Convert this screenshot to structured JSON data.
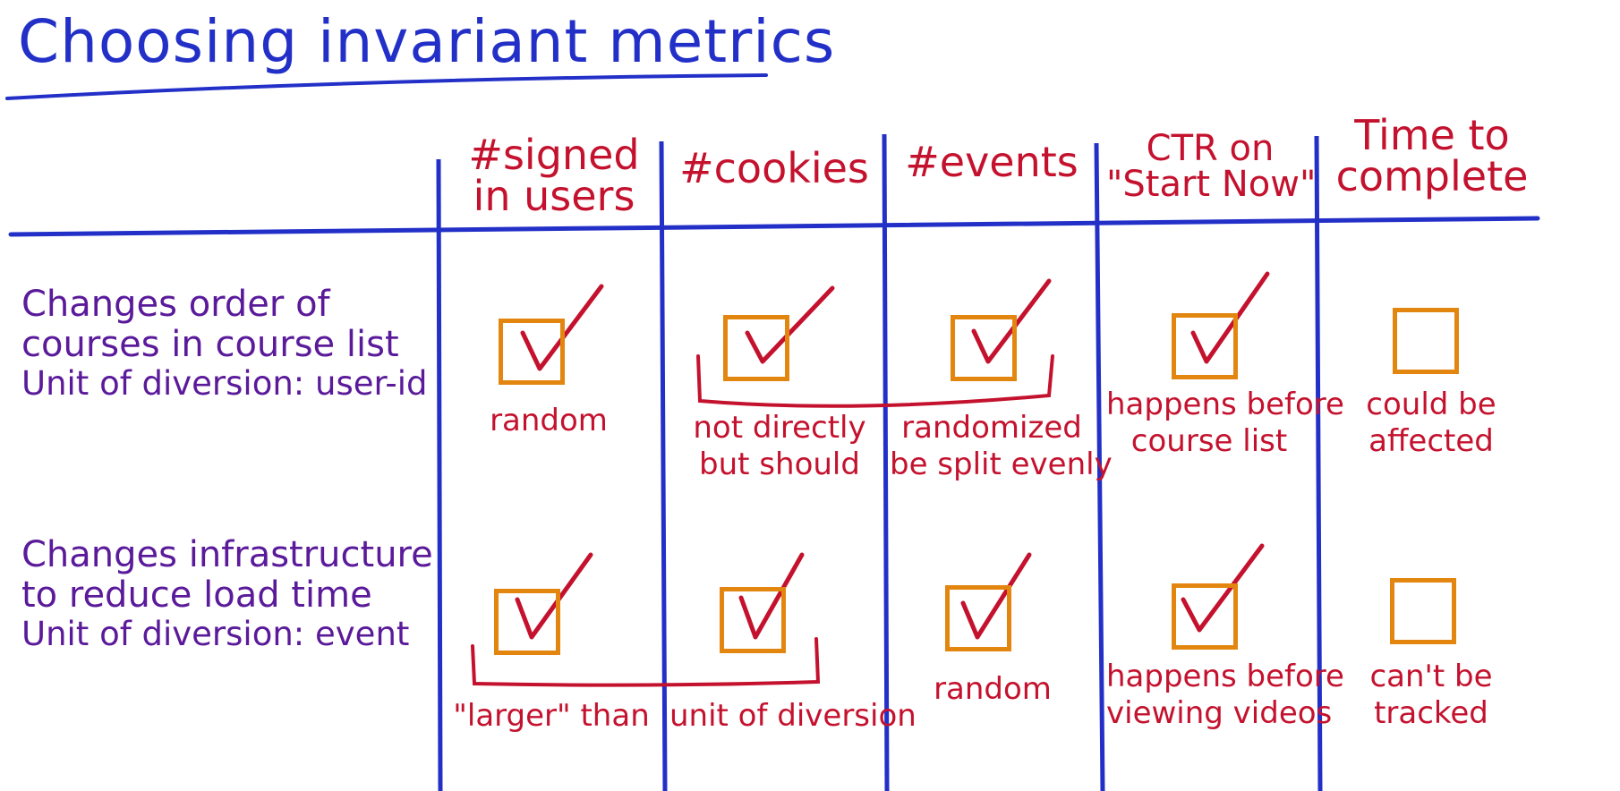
{
  "title": "Choosing invariant metrics",
  "columns": [
    {
      "label": "#signed in users",
      "lines": [
        "#signed",
        "in users"
      ]
    },
    {
      "label": "#cookies",
      "lines": [
        "#cookies"
      ]
    },
    {
      "label": "#events",
      "lines": [
        "#events"
      ]
    },
    {
      "label": "CTR on \"Start Now\"",
      "lines": [
        "CTR on",
        "\"Start Now\""
      ]
    },
    {
      "label": "Time to complete",
      "lines": [
        "Time to",
        "complete"
      ]
    }
  ],
  "rows": [
    {
      "lines": [
        "Changes order of",
        "courses in course list"
      ],
      "unit": "Unit of diversion: user-id",
      "cells": [
        {
          "checked": true
        },
        {
          "checked": true
        },
        {
          "checked": true
        },
        {
          "checked": true
        },
        {
          "checked": false
        }
      ],
      "notes": {
        "c1": [
          "random"
        ],
        "c2": [
          "not directly",
          "but should"
        ],
        "c3": [
          "randomized",
          "be split evenly"
        ],
        "c4": [
          "happens before",
          "course list"
        ],
        "c5": [
          "could be",
          "affected"
        ]
      }
    },
    {
      "lines": [
        "Changes infrastructure",
        "to reduce load time"
      ],
      "unit": "Unit of diversion: event",
      "cells": [
        {
          "checked": true
        },
        {
          "checked": true
        },
        {
          "checked": true
        },
        {
          "checked": true
        },
        {
          "checked": false
        }
      ],
      "notes": {
        "c1": [
          "\"larger\" than"
        ],
        "c2": [
          "unit of diversion"
        ],
        "c3": [
          "random"
        ],
        "c4": [
          "happens before",
          "viewing videos"
        ],
        "c5": [
          "can't be",
          "tracked"
        ]
      }
    }
  ],
  "colors": {
    "grid": "#2330c8",
    "ink_red": "#c4122e",
    "ink_purple": "#5a1a9a",
    "box_orange": "#e3860f"
  },
  "icons": {
    "checkmark": "checkmark-icon",
    "bracket": "bracket-icon"
  }
}
